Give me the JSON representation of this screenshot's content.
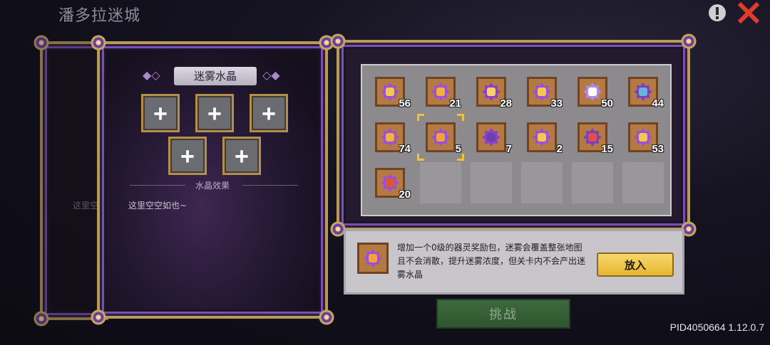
{
  "header": {
    "title": "潘多拉迷城",
    "info_icon": "exclamation-circle-icon",
    "close_icon": "red-x-close-icon"
  },
  "back_panel": {
    "empty_text": "这里空空"
  },
  "crystal_panel": {
    "title": "迷雾水晶",
    "slot_symbol": "+",
    "effect_title": "水晶效果",
    "empty_text": "这里空空如也~"
  },
  "inventory": {
    "items": [
      {
        "count": "56",
        "color": "#9a4fe0",
        "core": "#f2c94c"
      },
      {
        "count": "21",
        "color": "#9a4fe0",
        "core": "#f2b233"
      },
      {
        "count": "28",
        "color": "#8a3fd0",
        "core": "#f6d36a"
      },
      {
        "count": "33",
        "color": "#9a4fe0",
        "core": "#f2c94c"
      },
      {
        "count": "50",
        "color": "#b088f0",
        "core": "#ffffff"
      },
      {
        "count": "44",
        "color": "#7a3fc0",
        "core": "#6ab0e0"
      },
      {
        "count": "74",
        "color": "#9a4fe0",
        "core": "#f2b233"
      },
      {
        "count": "5",
        "color": "#9a4fe0",
        "core": "#f4a23a",
        "selected": true
      },
      {
        "count": "7",
        "color": "#8a3fd0",
        "core": "#6a3fb0"
      },
      {
        "count": "2",
        "color": "#9a4fe0",
        "core": "#f2c94c"
      },
      {
        "count": "15",
        "color": "#7a3fc0",
        "core": "#e04f4f"
      },
      {
        "count": "53",
        "color": "#9a4fe0",
        "core": "#f2c94c"
      },
      {
        "count": "20",
        "color": "#9a4fe0",
        "core": "#e0572f"
      }
    ],
    "total_slots": 18
  },
  "description": {
    "text": "增加一个0级的器灵奖励包，迷雾会覆盖整张地图且不会消散，提升迷雾浓度，但关卡内不会产出迷雾水晶",
    "button_label": "放入",
    "icon_color": "#9a4fe0",
    "icon_core": "#f4a23a"
  },
  "challenge_button": "挑战",
  "version": "PID4050664 1.12.0.7"
}
